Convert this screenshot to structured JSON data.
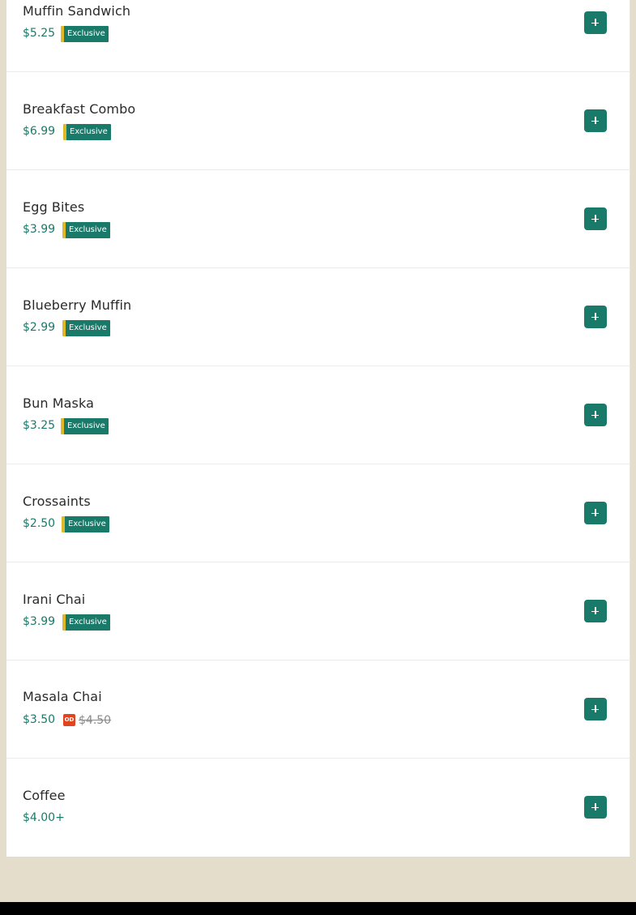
{
  "menu": {
    "items": [
      {
        "name": "Muffin Sandwich",
        "price": "$5.25",
        "badge": "Exclusive",
        "add_icon": "plus-icon"
      },
      {
        "name": "Breakfast Combo",
        "price": "$6.99",
        "badge": "Exclusive",
        "add_icon": "plus-icon"
      },
      {
        "name": "Egg Bites",
        "price": "$3.99",
        "badge": "Exclusive",
        "add_icon": "plus-icon"
      },
      {
        "name": "Blueberry Muffin",
        "price": "$2.99",
        "badge": "Exclusive",
        "add_icon": "plus-icon"
      },
      {
        "name": "Bun Maska",
        "price": "$3.25",
        "badge": "Exclusive",
        "add_icon": "plus-icon"
      },
      {
        "name": "Crossaints",
        "price": "$2.50",
        "badge": "Exclusive",
        "add_icon": "plus-icon"
      },
      {
        "name": "Irani Chai",
        "price": "$3.99",
        "badge": "Exclusive",
        "add_icon": "plus-icon"
      },
      {
        "name": "Masala Chai",
        "price": "$3.50",
        "offer_icon": "offer-tag-icon",
        "offer_icon_text": "OD",
        "original_price": "$4.50",
        "add_icon": "plus-icon"
      },
      {
        "name": "Coffee",
        "price": "$4.00+",
        "add_icon": "plus-icon"
      }
    ]
  },
  "colors": {
    "accent": "#1a7a6a",
    "badge_stripe": "#e0b92a",
    "offer": "#e0451f",
    "page_background": "#e5ddcb"
  }
}
